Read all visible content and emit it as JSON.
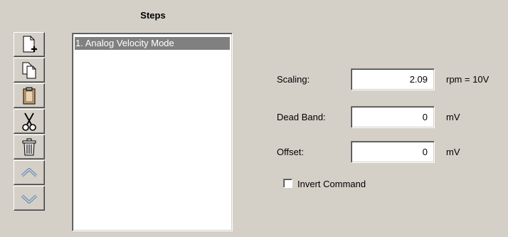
{
  "steps_panel": {
    "title": "Steps",
    "items": [
      {
        "label": "1. Analog Velocity Mode",
        "selected": true
      }
    ]
  },
  "toolbar": {
    "buttons": [
      {
        "name": "new-step-button",
        "icon": "new-document-icon"
      },
      {
        "name": "copy-step-button",
        "icon": "copy-icon"
      },
      {
        "name": "paste-step-button",
        "icon": "clipboard-icon"
      },
      {
        "name": "cut-step-button",
        "icon": "scissors-icon"
      },
      {
        "name": "delete-step-button",
        "icon": "trash-icon"
      },
      {
        "name": "move-up-button",
        "icon": "chevron-up-icon"
      },
      {
        "name": "move-down-button",
        "icon": "chevron-down-icon"
      }
    ]
  },
  "form": {
    "scaling": {
      "label": "Scaling:",
      "value": "2.09",
      "unit": "rpm = 10V"
    },
    "dead_band": {
      "label": "Dead Band:",
      "value": "0",
      "unit": "mV"
    },
    "offset": {
      "label": "Offset:",
      "value": "0",
      "unit": "mV"
    },
    "invert_command": {
      "label": "Invert Command",
      "checked": false
    }
  },
  "colors": {
    "window_bg": "#d4d0c8",
    "selection_bg": "#808080",
    "selection_text": "#ffffff"
  }
}
